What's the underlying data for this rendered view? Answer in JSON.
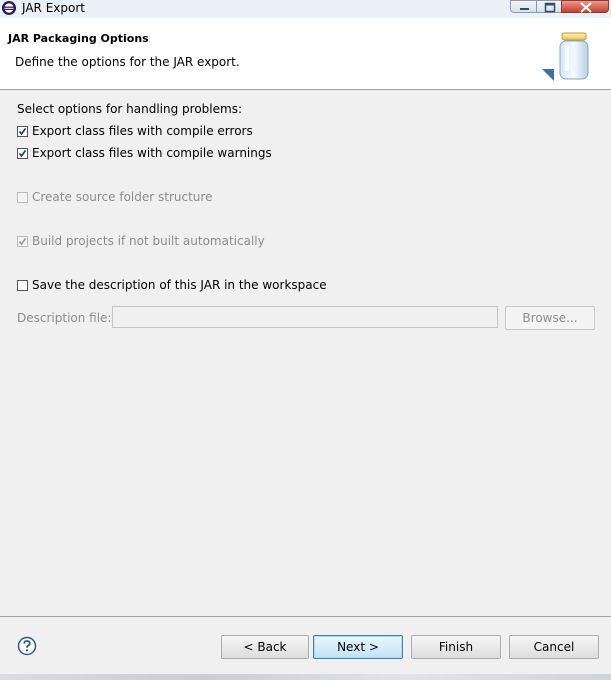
{
  "window": {
    "title": "JAR Export",
    "icon": "eclipse-icon"
  },
  "banner": {
    "title": "JAR Packaging Options",
    "description": "Define the options for the JAR export.",
    "image": "jar-icon"
  },
  "options": {
    "section_label": "Select options for handling problems:",
    "export_errors": {
      "label": "Export class files with compile errors",
      "checked": true,
      "enabled": true
    },
    "export_warnings": {
      "label": "Export class files with compile warnings",
      "checked": true,
      "enabled": true
    },
    "source_folder": {
      "label": "Create source folder structure",
      "checked": false,
      "enabled": false
    },
    "build_projects": {
      "label": "Build projects if not built automatically",
      "checked": true,
      "enabled": false
    },
    "save_description": {
      "label": "Save the description of this JAR in the workspace",
      "checked": false,
      "enabled": true
    },
    "description_file": {
      "label": "Description file:",
      "value": "",
      "enabled": false
    },
    "browse_label": "Browse..."
  },
  "footer": {
    "help_icon": "help-icon",
    "back_label": "< Back",
    "next_label": "Next >",
    "finish_label": "Finish",
    "cancel_label": "Cancel"
  },
  "colors": {
    "banner_bg": "#ffffff",
    "dialog_bg": "#f0f0f0",
    "default_button_border": "#3c7fb1"
  }
}
